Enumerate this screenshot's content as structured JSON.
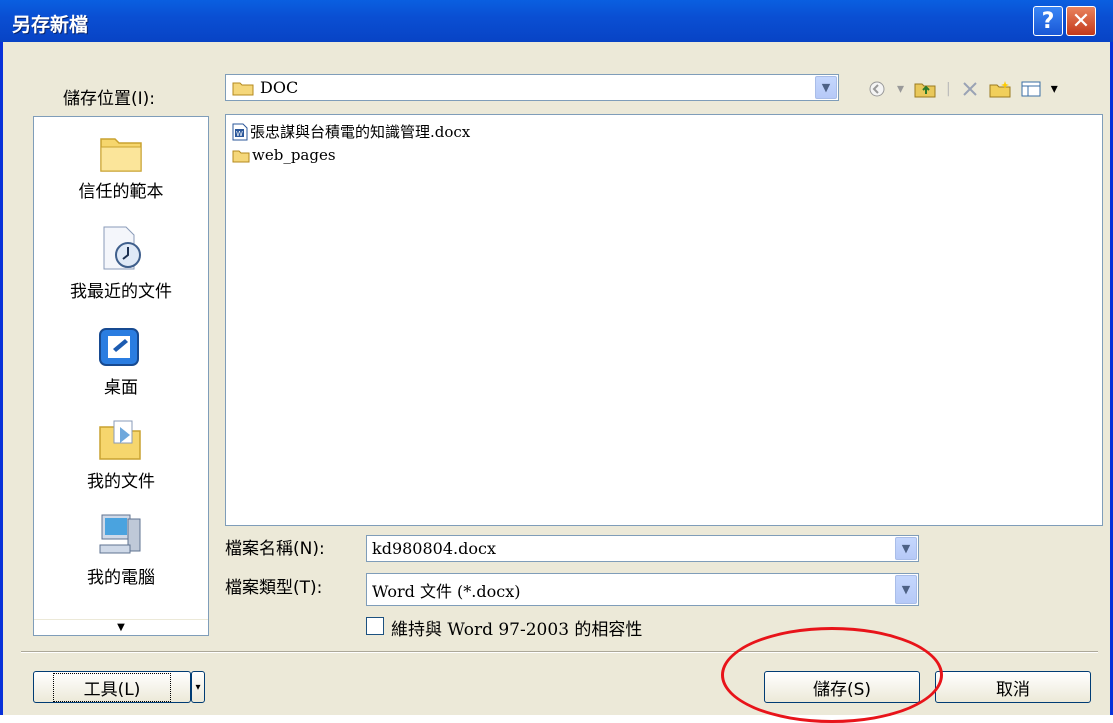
{
  "dialog": {
    "title": "另存新檔",
    "help_label": "?",
    "close_label": "✕"
  },
  "save_in": {
    "label": "儲存位置(I):",
    "value": "DOC"
  },
  "toolbar_icons": [
    "back-icon",
    "up-folder-icon",
    "delete-icon",
    "new-folder-icon",
    "views-icon"
  ],
  "places": [
    {
      "label": "信任的範本",
      "icon": "folder-icon"
    },
    {
      "label": "我最近的文件",
      "icon": "recent-documents-icon"
    },
    {
      "label": "桌面",
      "icon": "desktop-icon"
    },
    {
      "label": "我的文件",
      "icon": "my-documents-icon"
    },
    {
      "label": "我的電腦",
      "icon": "my-computer-icon"
    }
  ],
  "files": [
    {
      "name": "張忠謀與台積電的知識管理.docx",
      "icon": "word-document-icon"
    },
    {
      "name": "web_pages",
      "icon": "folder-icon"
    }
  ],
  "file_name": {
    "label": "檔案名稱(N):",
    "value": "kd980804.docx"
  },
  "file_type": {
    "label": "檔案類型(T):",
    "value": "Word 文件 (*.docx)"
  },
  "compat": {
    "label": "維持與 Word 97-2003 的相容性",
    "checked": false
  },
  "buttons": {
    "tools": "工具(L)",
    "save": "儲存(S)",
    "cancel": "取消"
  },
  "colors": {
    "titlebar": "#0a4fd3",
    "dialog_bg": "#ece9d8",
    "highlight_ellipse": "#e8141a"
  }
}
